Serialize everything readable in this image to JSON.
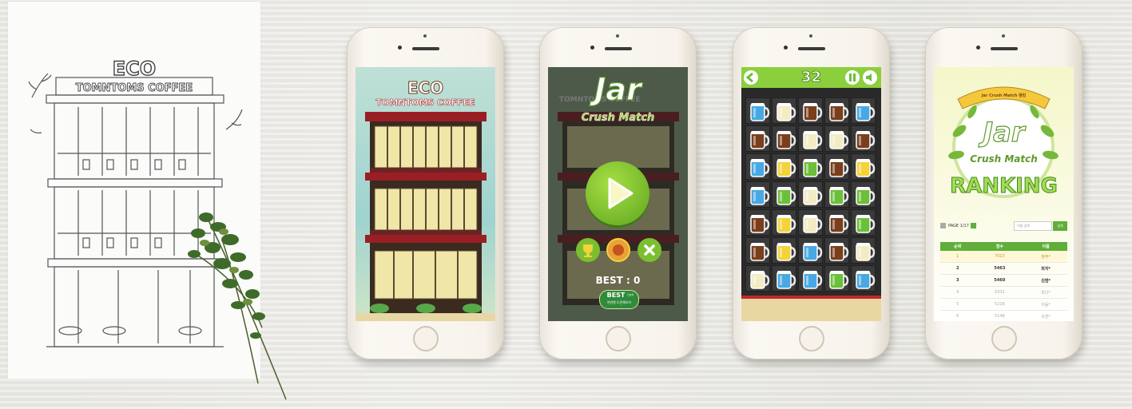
{
  "sketch": {
    "logo_main": "ECO",
    "logo_sub": "TOMNTOMS COFFEE"
  },
  "phone1": {
    "logo_main": "ECO",
    "logo_sub": "TOMNTOMS COFFEE"
  },
  "phone2": {
    "title_main": "Jar",
    "title_sub": "Crush Match",
    "bg_logo": "TOMNTOMS COFFEE",
    "play_label": "play",
    "best_label": "BEST : 0",
    "best_badge_title": "BEST",
    "best_badge_sub": "이번엔 도전해보기",
    "best_badge_tag": "오늘의"
  },
  "phone3": {
    "moves": "32",
    "grid_colors": {
      "blue": "#49a8e3",
      "cream": "#f3ebc4",
      "cola": "#7a3e1c",
      "yellow": "#f4d23a",
      "green": "#6cbf3a"
    },
    "grid": [
      [
        "blue",
        "cream",
        "cola",
        "cola",
        "blue"
      ],
      [
        "cola",
        "cola",
        "cream",
        "cream",
        "cola"
      ],
      [
        "blue",
        "yellow",
        "green",
        "cola",
        "yellow"
      ],
      [
        "blue",
        "green",
        "cream",
        "green",
        "green"
      ],
      [
        "cola",
        "yellow",
        "cream",
        "cola",
        "green"
      ],
      [
        "cola",
        "yellow",
        "blue",
        "cola",
        "cream"
      ],
      [
        "cream",
        "blue",
        "blue",
        "green",
        "blue"
      ]
    ]
  },
  "phone4": {
    "ribbon": "Jar Crush Match 랭킹",
    "title_main": "Jar",
    "title_sub": "Crush Match",
    "ranking": "RANKING",
    "page_label": "PAGE 1/17",
    "search_placeholder": "이름 검색",
    "search_button": "검색",
    "columns": [
      "순위",
      "점수",
      "이름"
    ],
    "rows": [
      {
        "rank": "1",
        "score": "7013",
        "name": "정주*"
      },
      {
        "rank": "2",
        "score": "5463",
        "name": "최지*"
      },
      {
        "rank": "3",
        "score": "5460",
        "name": "김범*"
      },
      {
        "rank": "4",
        "score": "5332",
        "name": "최다*"
      },
      {
        "rank": "5",
        "score": "5216",
        "name": "이동*"
      },
      {
        "rank": "6",
        "score": "5148",
        "name": "조연*"
      }
    ]
  }
}
